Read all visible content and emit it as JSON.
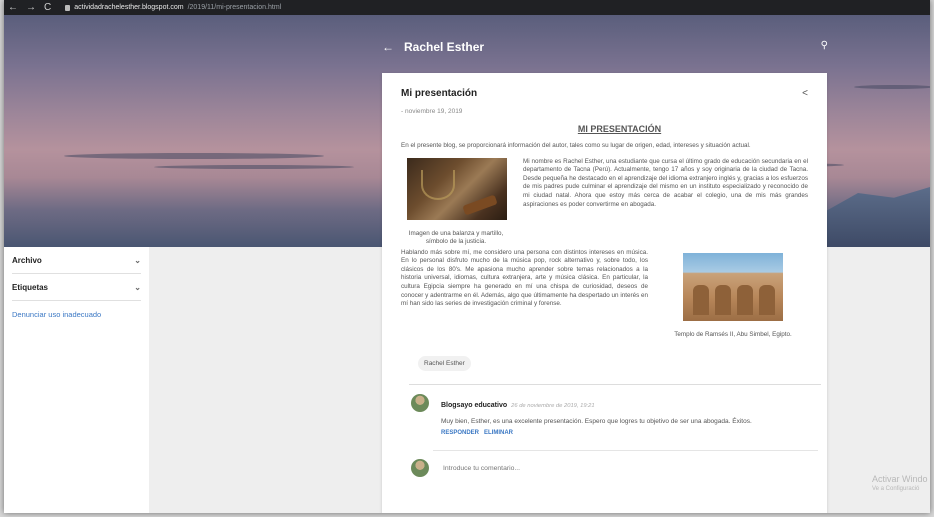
{
  "browser": {
    "back": "←",
    "forward": "→",
    "reload": "C",
    "url_host": "actividadrachelesther.blogspot.com",
    "url_path": "/2019/11/mi-presentacion.html"
  },
  "header": {
    "blog_title": "Rachel Esther"
  },
  "sidebar": {
    "items": [
      {
        "label": "Archivo"
      },
      {
        "label": "Etiquetas"
      }
    ],
    "report_link": "Denunciar uso inadecuado"
  },
  "post": {
    "title": "Mi presentación",
    "date": "- noviembre 19, 2019",
    "heading": "MI PRESENTACIÓN",
    "intro": "En el presente blog, se proporcionará información del autor, tales como su lugar de origen, edad, intereses y situación actual.",
    "para1": "Mi nombre es Rachel Esther, una estudiante que cursa el último grado de educación secundaria en el departamento de Tacna (Perú). Actualmente, tengo 17 años y soy originaria de la ciudad de Tacna. Desde pequeña he destacado en el aprendizaje del idioma extranjero inglés y, gracias a los esfuerzos de mis padres pude culminar el aprendizaje del mismo en un instituto especializado y reconocido de mi ciudad natal. Ahora que estoy más cerca de acabar el colegio, una de mis más grandes aspiraciones es poder convertirme en abogada.",
    "caption1": "Imagen de una balanza y martillo, símbolo de la justicia.",
    "para2": "Hablando más sobre mí, me considero una persona con distintos intereses en música. En lo personal disfruto mucho de la música pop, rock alternativo y, sobre todo, los clásicos de los 80's. Me apasiona mucho aprender sobre temas relacionados a la historia universal, idiomas, cultura extranjera, arte y música clásica. En particular, la cultura Egipcia siempre ha generado en mí una chispa de curiosidad, deseos de conocer y adentrarme en él. Además, algo que últimamente ha despertado un interés en mí han sido las series de investigación criminal y forense.",
    "caption2": "Templo de Ramsés II, Abu Simbel, Egipto.",
    "label": "Rachel Esther"
  },
  "comment": {
    "author": "Blogsayo educativo",
    "date": "26 de noviembre de 2019, 19:21",
    "text": "Muy bien, Esther, es una excelente presentación. Espero que logres tu objetivo de ser una abogada. Éxitos.",
    "reply": "RESPONDER",
    "delete": "ELIMINAR"
  },
  "new_comment": {
    "placeholder": "Introduce tu comentario..."
  },
  "watermark": {
    "line1": "Activar Windo",
    "line2": "Ve a Configuració"
  }
}
